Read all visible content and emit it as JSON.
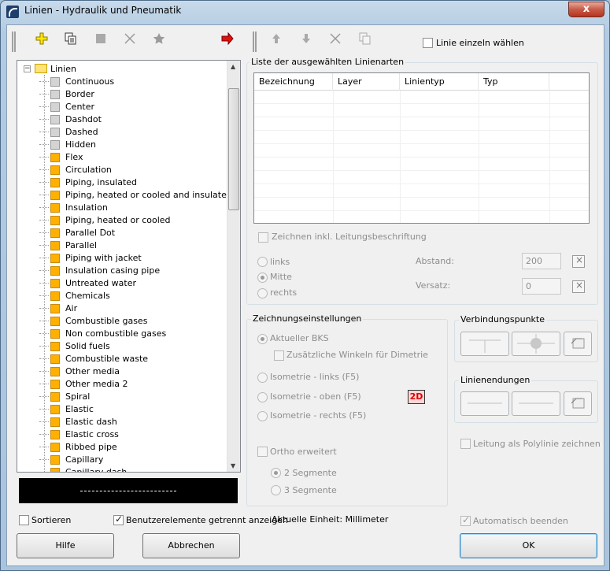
{
  "window": {
    "title": "Linien - Hydraulik und Pneumatik",
    "close_glyph": "x"
  },
  "toolbar_left_icons": [
    "new-item-icon",
    "copy-icon",
    "stop-icon",
    "delete-icon",
    "favorite-icon",
    "arrow-right-icon"
  ],
  "toolbar_right_icons": [
    "arrow-up-icon",
    "arrow-down-icon",
    "delete-icon",
    "copy-icon"
  ],
  "linie_einzeln": "Linie einzeln wählen",
  "tree": {
    "root": "Linien",
    "items": [
      {
        "label": "Continuous",
        "color": "#d4d4d4"
      },
      {
        "label": "Border",
        "color": "#d4d4d4"
      },
      {
        "label": "Center",
        "color": "#d4d4d4"
      },
      {
        "label": "Dashdot",
        "color": "#d4d4d4"
      },
      {
        "label": "Dashed",
        "color": "#d4d4d4"
      },
      {
        "label": "Hidden",
        "color": "#d4d4d4"
      },
      {
        "label": "Flex",
        "color": "#ffb000"
      },
      {
        "label": "Circulation",
        "color": "#ffb000"
      },
      {
        "label": "Piping, insulated",
        "color": "#ffb000"
      },
      {
        "label": "Piping, heated or cooled and insulated",
        "color": "#ffb000"
      },
      {
        "label": "Insulation",
        "color": "#ffb000"
      },
      {
        "label": "Piping, heated or cooled",
        "color": "#ffb000"
      },
      {
        "label": "Parallel Dot",
        "color": "#ffb000"
      },
      {
        "label": "Parallel",
        "color": "#ffb000"
      },
      {
        "label": "Piping with jacket",
        "color": "#ffb000"
      },
      {
        "label": "Insulation casing pipe",
        "color": "#ffb000"
      },
      {
        "label": "Untreated water",
        "color": "#ffb000"
      },
      {
        "label": "Chemicals",
        "color": "#ffb000"
      },
      {
        "label": "Air",
        "color": "#ffb000"
      },
      {
        "label": "Combustible gases",
        "color": "#ffb000"
      },
      {
        "label": "Non combustible gases",
        "color": "#ffb000"
      },
      {
        "label": "Solid fuels",
        "color": "#ffb000"
      },
      {
        "label": "Combustible waste",
        "color": "#ffb000"
      },
      {
        "label": "Other media",
        "color": "#ffb000"
      },
      {
        "label": "Other media 2",
        "color": "#ffb000"
      },
      {
        "label": "Spiral",
        "color": "#ffb000"
      },
      {
        "label": "Elastic",
        "color": "#ffb000"
      },
      {
        "label": "Elastic dash",
        "color": "#ffb000"
      },
      {
        "label": "Elastic cross",
        "color": "#ffb000"
      },
      {
        "label": "Ribbed pipe",
        "color": "#ffb000"
      },
      {
        "label": "Capillary",
        "color": "#ffb000"
      },
      {
        "label": "Capillary dash",
        "color": "#ffb000"
      }
    ]
  },
  "list": {
    "title": "Liste der ausgewählten Linienarten",
    "columns": [
      "Bezeichnung",
      "Layer",
      "Linientyp",
      "Typ"
    ]
  },
  "zeichnen_inkl": "Zeichnen inkl. Leitungsbeschriftung",
  "position": {
    "links": "links",
    "mitte": "Mitte",
    "rechts": "rechts",
    "abstand_label": "Abstand:",
    "abstand_value": "200",
    "versatz_label": "Versatz:",
    "versatz_value": "0"
  },
  "zeichnung": {
    "title": "Zeichnungseinstellungen",
    "aktueller_bks": "Aktueller BKS",
    "winkel_dimetrie": "Zusätzliche Winkeln für Dimetrie",
    "iso_links": "Isometrie - links (F5)",
    "iso_oben": "Isometrie - oben (F5)",
    "iso_rechts": "Isometrie - rechts  (F5)",
    "badge_2d": "2D",
    "ortho": "Ortho erweitert",
    "seg2": "2 Segmente",
    "seg3": "3 Segmente"
  },
  "verbindung": {
    "title": "Verbindungspunkte"
  },
  "endungen": {
    "title": "Linienendungen"
  },
  "polylinie": "Leitung als Polylinie zeichnen",
  "bottom": {
    "sortieren": "Sortieren",
    "benutzer": "Benutzerelemente getrennt anzeigen",
    "einheit": "Aktuelle Einheit: Millimeter",
    "auto_beenden": "Automatisch beenden",
    "hilfe": "Hilfe",
    "abbrechen": "Abbrechen",
    "ok": "OK"
  }
}
